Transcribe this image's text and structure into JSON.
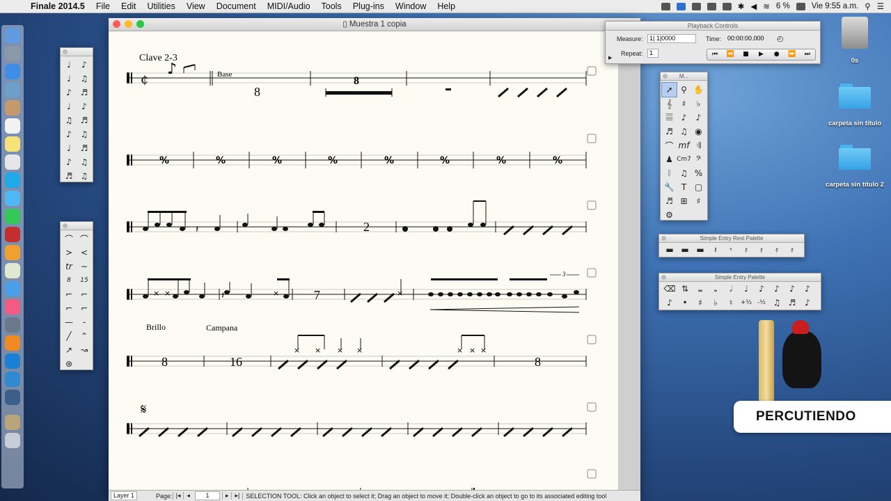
{
  "menubar": {
    "app_name": "Finale 2014.5",
    "items": [
      "File",
      "Edit",
      "Utilities",
      "View",
      "Document",
      "MIDI/Audio",
      "Tools",
      "Plug-ins",
      "Window",
      "Help"
    ],
    "battery": "6 %",
    "clock": "Vie 9:55 a.m."
  },
  "window": {
    "title": "Muestra 1 copia",
    "status": {
      "layer_label": "Layer 1",
      "page_label": "Page:",
      "page_value": "1",
      "tool_message": "SELECTION TOOL: Click an object to select it; Drag an object to move it; Double-click an object to go to its associated editing tool"
    }
  },
  "score": {
    "staff1_title": "Clave 2-3",
    "base_label": "Base",
    "rest_8": "8",
    "mm_rest_8": "8",
    "rest_2": "2",
    "rest_7": "7",
    "triplet": "3",
    "brillo_label": "Brillo",
    "campana_label": "Campana",
    "rest_brillo": "8",
    "rest_16": "16",
    "rest_end_8": "8"
  },
  "playback": {
    "title": "Playback Controls",
    "measure_label": "Measure:",
    "measure_value": "1| 1|0000",
    "time_label": "Time:",
    "time_value": "00:00:00.000",
    "repeat_label": "Repeat:",
    "repeat_value": "1"
  },
  "main_tool_palette": {
    "title": "M..."
  },
  "rest_palette": {
    "title": "Simple Entry Rest Palette"
  },
  "simple_entry_palette": {
    "title": "Simple Entry Palette"
  },
  "desktop": {
    "disk_label": "0s",
    "folder1": "carpeta sin título",
    "folder2": "carpeta sin título 2",
    "logo_text": "PERCUTIENDO"
  }
}
